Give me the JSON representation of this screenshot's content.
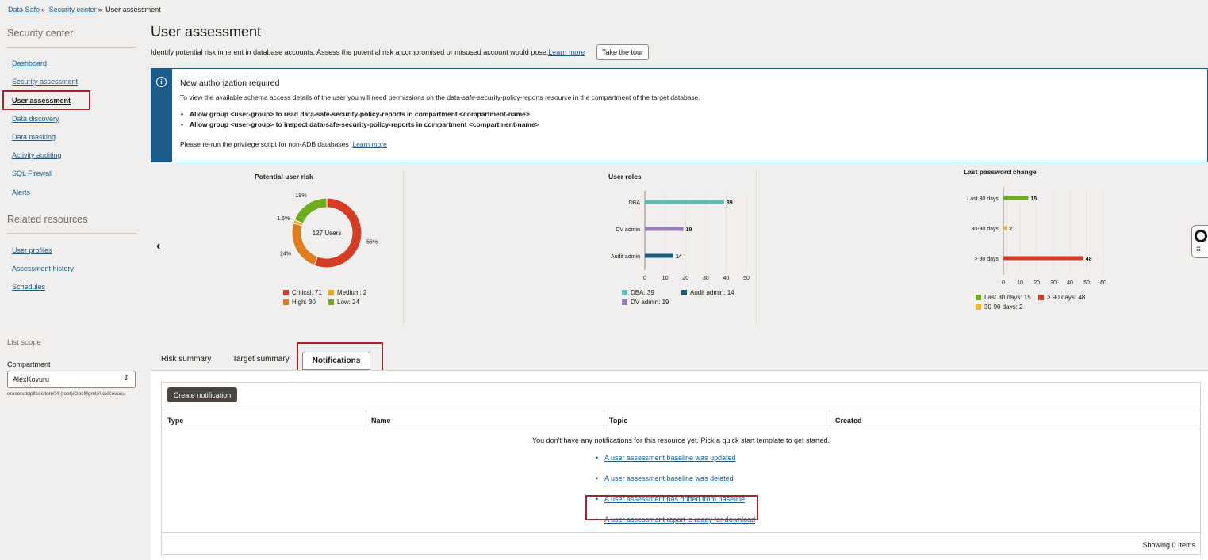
{
  "breadcrumb": {
    "items": [
      "Data Safe",
      "Security center"
    ],
    "sep": "»",
    "current": "User assessment"
  },
  "sidebar": {
    "heading": "Security center",
    "items": [
      {
        "label": "Dashboard"
      },
      {
        "label": "Security assessment"
      },
      {
        "label": "User assessment"
      },
      {
        "label": "Data discovery"
      },
      {
        "label": "Data masking"
      },
      {
        "label": "Activity auditing"
      },
      {
        "label": "SQL Firewall"
      },
      {
        "label": "Alerts"
      }
    ],
    "related_heading": "Related resources",
    "related": [
      {
        "label": "User profiles"
      },
      {
        "label": "Assessment history"
      },
      {
        "label": "Schedules"
      }
    ],
    "scope": {
      "title": "List scope",
      "compartment_label": "Compartment",
      "compartment_value": "AlexKovuru",
      "compartment_path": "orasenatdpltsecitom04 (root)/ObsMgmt/AlexKovuru"
    }
  },
  "header": {
    "title": "User assessment",
    "intro": "Identify potential risk inherent in database accounts. Assess the potential risk a compromised or misused account would pose.",
    "learn_more": "Learn more",
    "tour_button": "Take the tour"
  },
  "alert": {
    "icon": "info-icon",
    "title": "New authorization required",
    "body": "To view the available schema access details of the user you will need permissions on the data-safe-security-policy-reports resource in the compartment of the target database.",
    "bullets": [
      "Allow group <user-group> to read data-safe-security-policy-reports in compartment <compartment-name>",
      "Allow group <user-group> to inspect data-safe-security-policy-reports in compartment <compartment-name>"
    ],
    "footer": "Please re-run the privilege script for non-ADB databases",
    "footer_link": "Learn more"
  },
  "chart_data": [
    {
      "type": "pie",
      "title": "Potential user risk",
      "center_label": "127 Users",
      "slices": [
        {
          "name": "Critical",
          "value": 71,
          "pct_label": "56%",
          "color": "#d63b25"
        },
        {
          "name": "Medium",
          "value": 2,
          "pct_label": "1.6%",
          "color": "#f0a51e"
        },
        {
          "name": "High",
          "value": 30,
          "pct_label": "24%",
          "color": "#e07c1e"
        },
        {
          "name": "Low",
          "value": 24,
          "pct_label": "19%",
          "color": "#6fac1e"
        }
      ],
      "legend": [
        "Critical: 71",
        "Medium: 2",
        "High: 30",
        "Low: 24"
      ]
    },
    {
      "type": "bar",
      "orientation": "horizontal",
      "title": "User roles",
      "categories": [
        "DBA",
        "DV admin",
        "Audit admin"
      ],
      "values": [
        39,
        19,
        14
      ],
      "colors": [
        "#5fbdb5",
        "#9b7eb5",
        "#1d5a7a"
      ],
      "xlim": [
        0,
        50
      ],
      "xticks": [
        0,
        10,
        20,
        30,
        40,
        50
      ],
      "legend": [
        "DBA: 39",
        "Audit admin: 14",
        "DV admin: 19"
      ]
    },
    {
      "type": "bar",
      "orientation": "horizontal",
      "title": "Last password change",
      "categories": [
        "Last 30 days",
        "30-90 days",
        "> 90 days"
      ],
      "values": [
        15,
        2,
        48
      ],
      "colors": [
        "#6fac1e",
        "#f0b42a",
        "#d63b25"
      ],
      "xlim": [
        0,
        60
      ],
      "xticks": [
        0,
        10,
        20,
        30,
        40,
        50,
        60
      ],
      "legend": [
        "Last 30 days: 15",
        "> 90 days: 48",
        "30-90 days: 2"
      ]
    }
  ],
  "tabs": [
    {
      "label": "Risk summary"
    },
    {
      "label": "Target summary"
    },
    {
      "label": "Notifications",
      "active": true
    }
  ],
  "notifications": {
    "create_button": "Create notification",
    "columns": [
      "Type",
      "Name",
      "Topic",
      "Created"
    ],
    "empty_message": "You don't have any notifications for this resource yet. Pick a quick start template to get started.",
    "templates": [
      "A user assessment baseline was updated",
      "A user assessment baseline was deleted",
      "A user assessment has drifted from baseline",
      "A user assessment report is ready for download"
    ],
    "showing": "Showing 0 Items"
  }
}
